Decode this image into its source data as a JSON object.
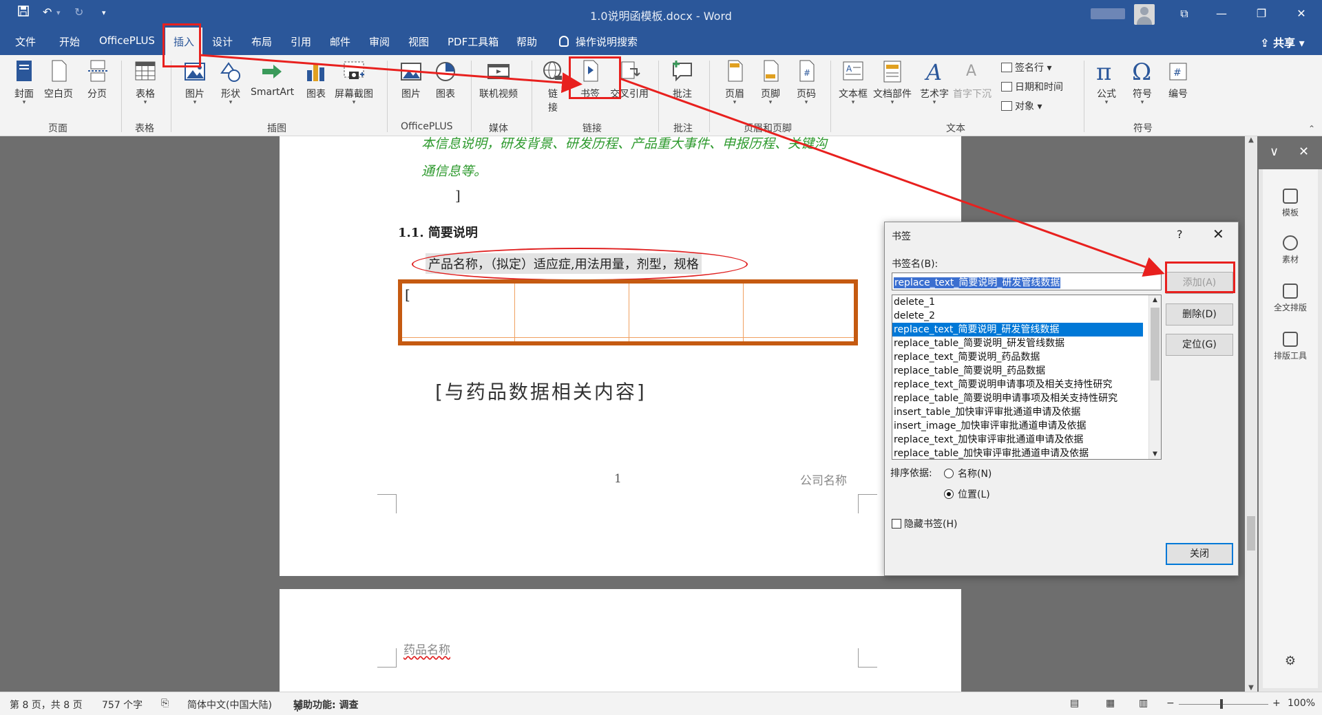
{
  "titlebar": {
    "title": "1.0说明函模板.docx  -  Word",
    "save_icon": "save-icon",
    "undo_icon": "undo-icon",
    "redo_icon": "redo-icon"
  },
  "menu": {
    "tabs": [
      "文件",
      "开始",
      "OfficePLUS",
      "插入",
      "设计",
      "布局",
      "引用",
      "邮件",
      "审阅",
      "视图",
      "PDF工具箱",
      "帮助"
    ],
    "active": "插入",
    "tell_me": "操作说明搜索",
    "share": "共享"
  },
  "ribbon": {
    "buttons": {
      "cover": "封面",
      "blank": "空白页",
      "break": "分页",
      "table": "表格",
      "picture": "图片",
      "shapes": "形状",
      "smartart": "SmartArt",
      "chart": "图表",
      "screenshot": "屏幕截图",
      "op_picture": "图片",
      "op_chart": "图表",
      "video": "联机视频",
      "link_1": "链",
      "link_2": "接",
      "bookmark": "书签",
      "crossref": "交叉引用",
      "comment": "批注",
      "header": "页眉",
      "footer": "页脚",
      "pagenum": "页码",
      "textbox": "文本框",
      "quickparts": "文档部件",
      "wordart": "艺术字",
      "dropcap": "首字下沉",
      "signature": "签名行",
      "datetime": "日期和时间",
      "object": "对象",
      "equation": "公式",
      "symbol": "符号",
      "number": "编号"
    },
    "groups": [
      "页面",
      "表格",
      "插图",
      "OfficePLUS",
      "媒体",
      "链接",
      "批注",
      "页眉和页脚",
      "文本",
      "符号"
    ]
  },
  "document": {
    "green_line1": "本信息说明，研发背景、研发历程、产品重大事件、申报历程、关键沟",
    "green_line2": "通信息等。",
    "bracket_close": "]",
    "heading": "1.1. 简要说明",
    "highlight_text": "产品名称，（拟定）适应症,用法用量，剂型，规格",
    "table_cell_bracket": "[",
    "big_text": "[与药品数据相关内容]",
    "page_number": "1",
    "company": "公司名称",
    "page2_header": "药品名称"
  },
  "dialog": {
    "title": "书签",
    "help": "?",
    "close": "✕",
    "name_label": "书签名(B):",
    "name_value": "replace_text_简要说明_研发管线数据",
    "items": [
      "delete_1",
      "delete_2",
      "replace_text_简要说明_研发管线数据",
      "replace_table_简要说明_研发管线数据",
      "replace_text_简要说明_药品数据",
      "replace_table_简要说明_药品数据",
      "replace_text_简要说明申请事项及相关支持性研究",
      "replace_table_简要说明申请事项及相关支持性研究",
      "insert_table_加快审评审批通道申请及依据",
      "insert_image_加快审评审批通道申请及依据",
      "replace_text_加快审评审批通道申请及依据",
      "replace_table_加快审评审批通道申请及依据"
    ],
    "selected_index": 2,
    "add_button": "添加(A)",
    "delete_button": "删除(D)",
    "goto_button": "定位(G)",
    "sort_label": "排序依据:",
    "sort_name": "名称(N)",
    "sort_location": "位置(L)",
    "sort_selected": "位置(L)",
    "hidden_label": "隐藏书签(H)",
    "hidden_checked": false,
    "close_button": "关闭"
  },
  "pane": {
    "items": [
      "模板",
      "素材",
      "全文排版",
      "排版工具"
    ]
  },
  "status": {
    "page": "第 8 页，共 8 页",
    "words": "757 个字",
    "language": "简体中文(中国大陆)",
    "accessibility": "辅助功能: 调查",
    "zoom": "100%"
  }
}
